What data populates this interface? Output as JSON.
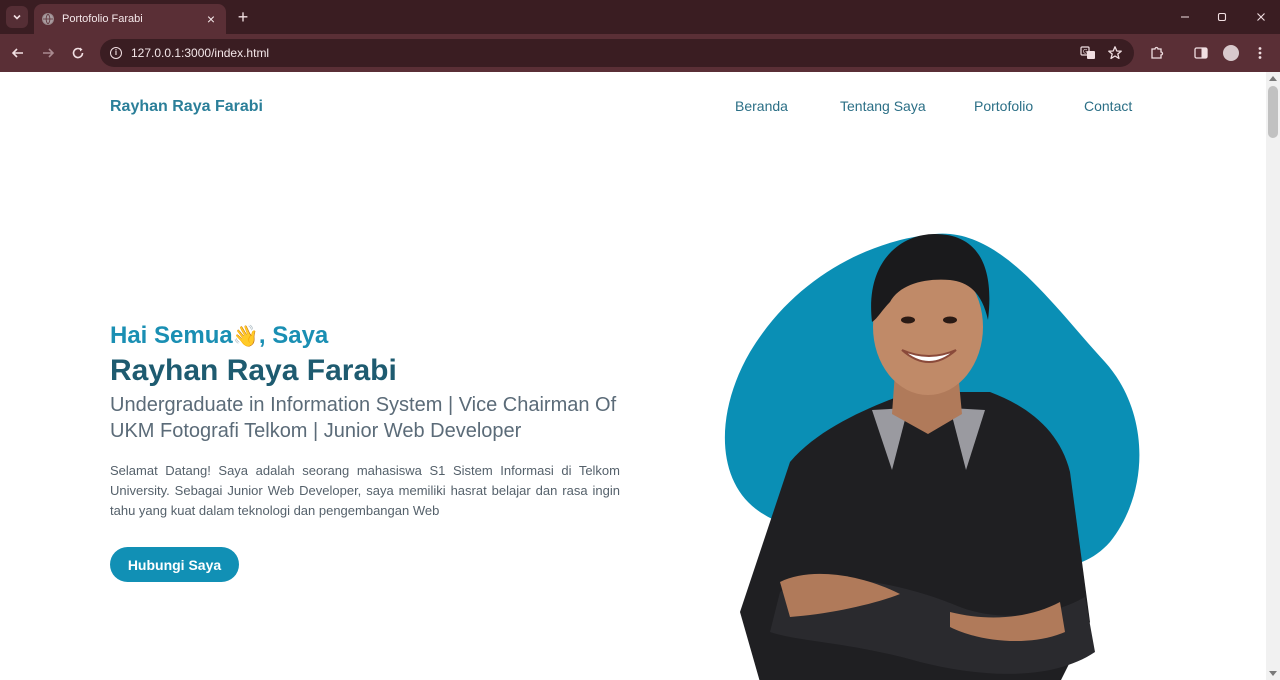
{
  "browser": {
    "tab_title": "Portofolio Farabi",
    "url": "127.0.0.1:3000/index.html"
  },
  "icons": {
    "tab_search": "chevron-down-icon",
    "favicon": "globe-icon",
    "tab_close": "close-icon",
    "new_tab": "plus-icon",
    "back": "arrow-left-icon",
    "forward": "arrow-right-icon",
    "reload": "reload-icon",
    "site_info": "info-icon",
    "translate": "translate-icon",
    "bookmark": "star-icon",
    "extensions": "puzzle-icon",
    "side_panel": "side-panel-icon",
    "profile": "avatar",
    "menu": "kebab-menu-icon"
  },
  "page": {
    "brand": "Rayhan Raya Farabi",
    "nav": [
      "Beranda",
      "Tentang Saya",
      "Portofolio",
      "Contact"
    ],
    "hero": {
      "greeting_prefix": "Hai Semua",
      "greeting_emoji": "👋",
      "greeting_suffix": ", Saya",
      "name": "Rayhan Raya Farabi",
      "role": "Undergraduate in Information System | Vice Chairman Of UKM Fotografi Telkom | Junior Web Developer",
      "description": "Selamat Datang! Saya adalah seorang mahasiswa S1 Sistem Informasi di Telkom University. Sebagai Junior Web Developer, saya memiliki hasrat belajar dan rasa ingin tahu yang kuat dalam teknologi dan pengembangan Web",
      "cta_label": "Hubungi Saya"
    }
  },
  "colors": {
    "chrome_dark": "#3a1d22",
    "chrome_toolbar": "#5a2f36",
    "brand": "#2b7f99",
    "accent": "#1190b5",
    "blob": "#0a8fb5",
    "heading": "#1e5b70"
  }
}
